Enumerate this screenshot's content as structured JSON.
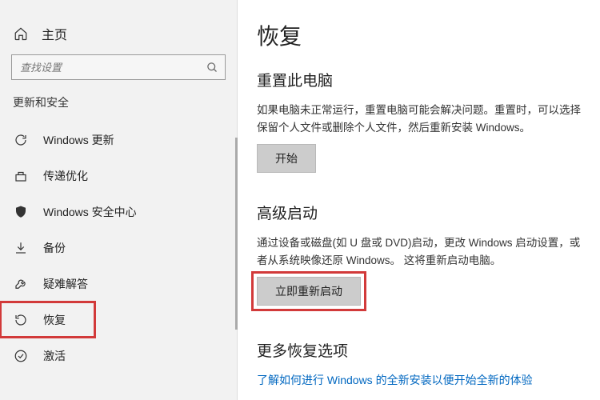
{
  "home_label": "主页",
  "search": {
    "placeholder": "查找设置"
  },
  "section_label": "更新和安全",
  "sidebar": {
    "items": [
      {
        "label": "Windows 更新"
      },
      {
        "label": "传递优化"
      },
      {
        "label": "Windows 安全中心"
      },
      {
        "label": "备份"
      },
      {
        "label": "疑难解答"
      },
      {
        "label": "恢复"
      },
      {
        "label": "激活"
      }
    ]
  },
  "content": {
    "title": "恢复",
    "reset": {
      "heading": "重置此电脑",
      "desc": "如果电脑未正常运行，重置电脑可能会解决问题。重置时，可以选择保留个人文件或删除个人文件，然后重新安装 Windows。",
      "button": "开始"
    },
    "advanced": {
      "heading": "高级启动",
      "desc": "通过设备或磁盘(如 U 盘或 DVD)启动，更改 Windows 启动设置，或者从系统映像还原 Windows。  这将重新启动电脑。",
      "button": "立即重新启动"
    },
    "more": {
      "heading": "更多恢复选项",
      "link": "了解如何进行 Windows 的全新安装以便开始全新的体验"
    }
  }
}
